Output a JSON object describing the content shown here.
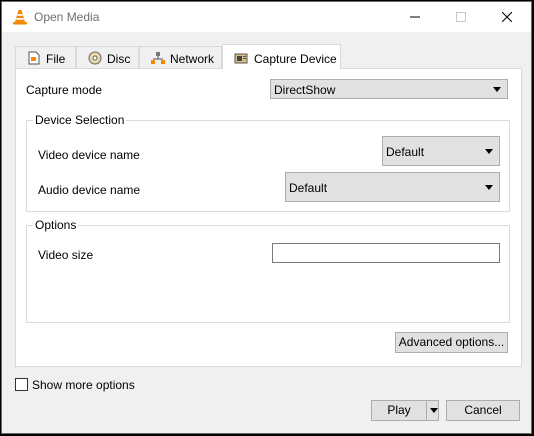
{
  "window": {
    "title": "Open Media",
    "controls": {
      "minimize": "minimize",
      "maximize": "maximize",
      "close": "close"
    }
  },
  "tabs": [
    {
      "label": "File",
      "icon": "file-icon",
      "active": false
    },
    {
      "label": "Disc",
      "icon": "disc-icon",
      "active": false
    },
    {
      "label": "Network",
      "icon": "network-icon",
      "active": false
    },
    {
      "label": "Capture Device",
      "icon": "capture-device-icon",
      "active": true
    }
  ],
  "capture": {
    "mode_label": "Capture mode",
    "mode_value": "DirectShow",
    "device_group": {
      "title": "Device Selection",
      "video_label": "Video device name",
      "video_value": "Default",
      "audio_label": "Audio device name",
      "audio_value": "Default"
    },
    "options_group": {
      "title": "Options",
      "video_size_label": "Video size",
      "video_size_value": ""
    },
    "advanced_button": "Advanced options..."
  },
  "footer": {
    "show_more_label": "Show more options",
    "show_more_checked": false,
    "play_label": "Play",
    "cancel_label": "Cancel"
  },
  "colors": {
    "vlc_orange": "#f18a00",
    "window_bg": "#f0f0f0",
    "button_bg": "#e1e1e1"
  }
}
